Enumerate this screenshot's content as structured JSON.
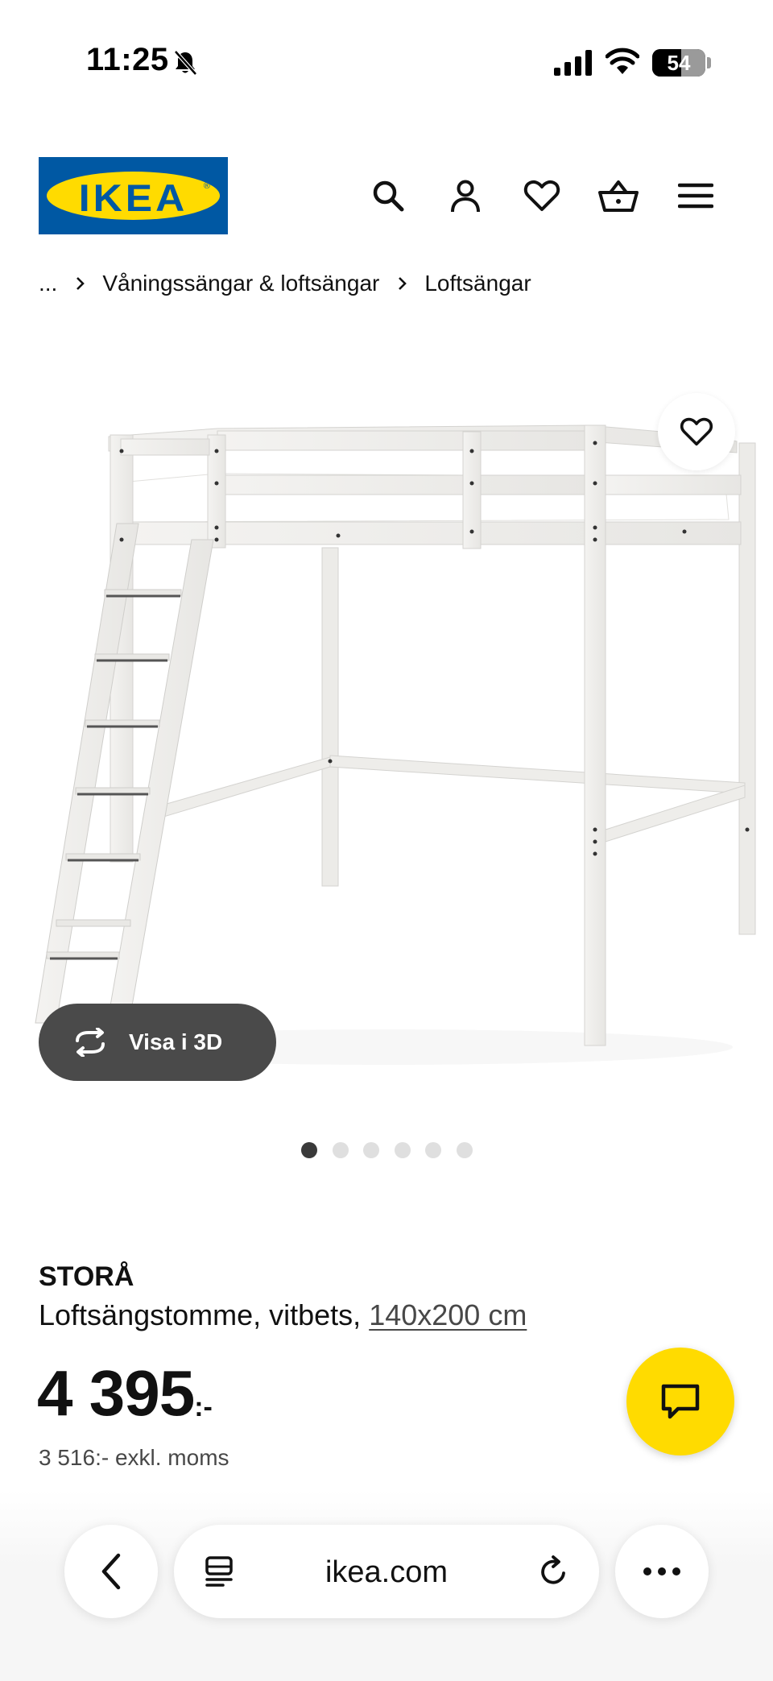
{
  "status_bar": {
    "time": "11:25",
    "battery": "54",
    "battery_level": 0.54,
    "icons": [
      "bell-muted-icon",
      "signal-icon",
      "wifi-icon",
      "battery-icon"
    ]
  },
  "header": {
    "logo_text": "IKEA",
    "icons": [
      "search-icon",
      "account-icon",
      "heart-icon",
      "cart-icon",
      "menu-icon"
    ]
  },
  "breadcrumb": {
    "items": [
      "...",
      "Våningssängar & loftsängar",
      "Loftsängar"
    ]
  },
  "product_media": {
    "image_alt": "white loft bed frame with ladder",
    "view_3d_label": "Visa i 3D",
    "dots_total": 6,
    "dots_active_index": 0
  },
  "product": {
    "name": "STORÅ",
    "description": "Loftsängstomme, vitbets,",
    "size_link": "140x200 cm",
    "price": "4 395",
    "price_suffix": ":-",
    "price_excl_vat": "3 516:- exkl. moms"
  },
  "browser": {
    "url": "ikea.com",
    "icons": [
      "back-icon",
      "tabs-icon",
      "reload-icon",
      "more-icon"
    ]
  },
  "colors": {
    "ikea_blue": "#0058a3",
    "ikea_yellow": "#ffdb00",
    "view3d_bg": "#4a4a4a"
  }
}
